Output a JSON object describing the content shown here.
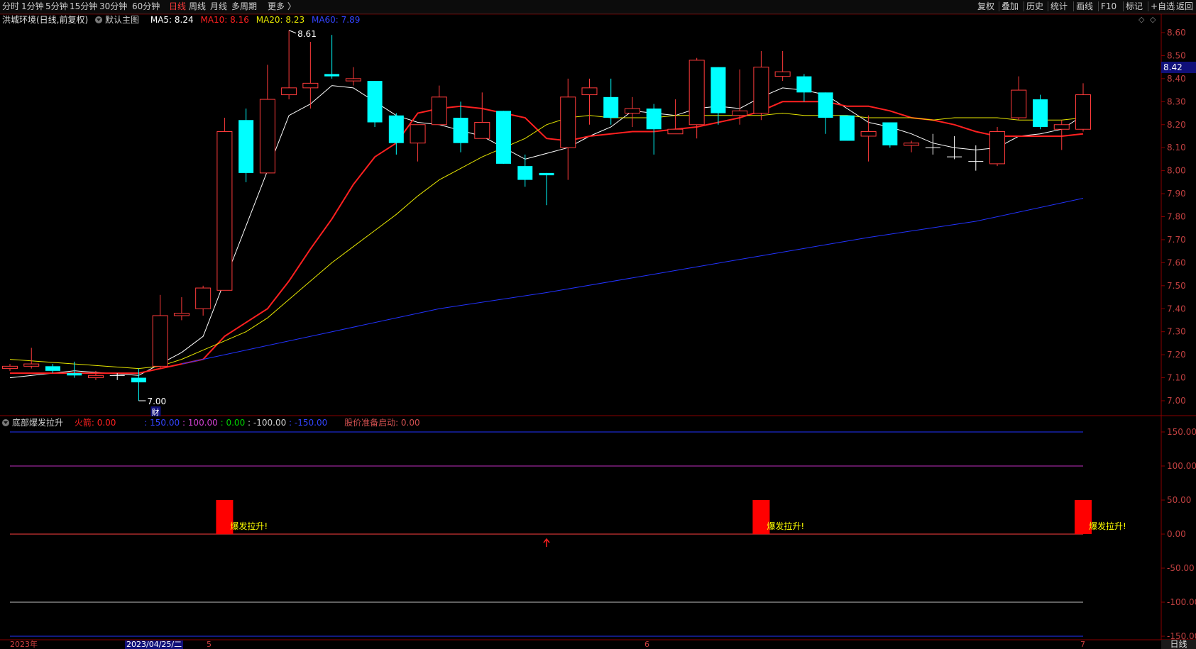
{
  "toolbar": {
    "left_items": [
      {
        "label": "分时",
        "active": false
      },
      {
        "label": "1分钟",
        "active": false
      },
      {
        "label": "5分钟",
        "active": false
      },
      {
        "label": "15分钟",
        "active": false
      },
      {
        "label": "30分钟",
        "active": false
      },
      {
        "label": "60分钟",
        "active": false
      },
      {
        "label": "日线",
        "active": true
      },
      {
        "label": "周线",
        "active": false
      },
      {
        "label": "月线",
        "active": false
      },
      {
        "label": "多周期",
        "active": false
      },
      {
        "label": "更多 〉",
        "active": false
      }
    ],
    "right_items": [
      "复权",
      "叠加",
      "历史",
      "统计",
      "画线",
      "F10",
      "标记",
      "+自选",
      "返回"
    ]
  },
  "main_legend": {
    "title": "洪城环境(日线,前复权)",
    "template": "默认主图",
    "ma5": "MA5: 8.24",
    "ma10": "MA10: 8.16",
    "ma20": "MA20: 8.23",
    "ma60": "MA60: 7.89"
  },
  "indicator_legend": {
    "name": "底部爆发拉升",
    "huojian": "火箭: 0.00",
    "v1": ": 150.00",
    "v2": ": 100.00",
    "v3": ": 0.00",
    "v4": ": -100.00",
    "v5": ": -150.00",
    "start": "股价准备启动: 0.00"
  },
  "current_price": "8.42",
  "timeframe": "日线",
  "dates": {
    "year": "2023年",
    "cursor": "2023/04/25/二",
    "m5": "5",
    "m6": "6",
    "m7": "7"
  },
  "colors": {
    "up": "#ff3b3b",
    "down": "#00ffff",
    "ma5": "#ffffff",
    "ma10": "#ff2020",
    "ma20": "#e6e600",
    "ma60": "#2233ff"
  },
  "chart_data": [
    {
      "type": "candlestick",
      "title": "洪城环境(日线,前复权)",
      "ylim": [
        7.0,
        8.6
      ],
      "y_ticks": [
        "8.60",
        "8.50",
        "8.40",
        "8.30",
        "8.20",
        "8.10",
        "8.00",
        "7.90",
        "7.80",
        "7.70",
        "7.60",
        "7.50",
        "7.40",
        "7.30",
        "7.20",
        "7.10",
        "7.00"
      ],
      "annotations": {
        "high": "8.61",
        "low": "7.00",
        "mark": "财"
      },
      "candles": [
        {
          "o": 7.14,
          "h": 7.16,
          "l": 7.13,
          "c": 7.15
        },
        {
          "o": 7.15,
          "h": 7.23,
          "l": 7.14,
          "c": 7.16
        },
        {
          "o": 7.15,
          "h": 7.16,
          "l": 7.12,
          "c": 7.13
        },
        {
          "o": 7.12,
          "h": 7.17,
          "l": 7.1,
          "c": 7.11
        },
        {
          "o": 7.1,
          "h": 7.13,
          "l": 7.09,
          "c": 7.11
        },
        {
          "o": 7.11,
          "h": 7.12,
          "l": 7.09,
          "c": 7.11
        },
        {
          "o": 7.1,
          "h": 7.14,
          "l": 7.0,
          "c": 7.08
        },
        {
          "o": 7.15,
          "h": 7.46,
          "l": 7.14,
          "c": 7.37
        },
        {
          "o": 7.37,
          "h": 7.45,
          "l": 7.35,
          "c": 7.38
        },
        {
          "o": 7.4,
          "h": 7.5,
          "l": 7.37,
          "c": 7.49
        },
        {
          "o": 7.48,
          "h": 8.23,
          "l": 7.48,
          "c": 8.17
        },
        {
          "o": 8.22,
          "h": 8.27,
          "l": 7.95,
          "c": 7.99
        },
        {
          "o": 7.99,
          "h": 8.46,
          "l": 7.99,
          "c": 8.31
        },
        {
          "o": 8.33,
          "h": 8.61,
          "l": 8.31,
          "c": 8.36
        },
        {
          "o": 8.36,
          "h": 8.56,
          "l": 8.27,
          "c": 8.38
        },
        {
          "o": 8.42,
          "h": 8.59,
          "l": 8.4,
          "c": 8.41
        },
        {
          "o": 8.39,
          "h": 8.45,
          "l": 8.37,
          "c": 8.4
        },
        {
          "o": 8.39,
          "h": 8.39,
          "l": 8.19,
          "c": 8.21
        },
        {
          "o": 8.24,
          "h": 8.25,
          "l": 8.07,
          "c": 8.12
        },
        {
          "o": 8.12,
          "h": 8.2,
          "l": 8.04,
          "c": 8.2
        },
        {
          "o": 8.2,
          "h": 8.37,
          "l": 8.2,
          "c": 8.32
        },
        {
          "o": 8.23,
          "h": 8.3,
          "l": 8.08,
          "c": 8.12
        },
        {
          "o": 8.14,
          "h": 8.34,
          "l": 8.14,
          "c": 8.21
        },
        {
          "o": 8.26,
          "h": 8.26,
          "l": 8.03,
          "c": 8.03
        },
        {
          "o": 8.02,
          "h": 8.07,
          "l": 7.93,
          "c": 7.96
        },
        {
          "o": 7.99,
          "h": 7.99,
          "l": 7.85,
          "c": 7.98
        },
        {
          "o": 8.1,
          "h": 8.4,
          "l": 7.96,
          "c": 8.32
        },
        {
          "o": 8.33,
          "h": 8.4,
          "l": 8.2,
          "c": 8.36
        },
        {
          "o": 8.32,
          "h": 8.4,
          "l": 8.2,
          "c": 8.23
        },
        {
          "o": 8.25,
          "h": 8.32,
          "l": 8.19,
          "c": 8.27
        },
        {
          "o": 8.27,
          "h": 8.29,
          "l": 8.07,
          "c": 8.18
        },
        {
          "o": 8.16,
          "h": 8.31,
          "l": 8.16,
          "c": 8.18
        },
        {
          "o": 8.2,
          "h": 8.49,
          "l": 8.14,
          "c": 8.48
        },
        {
          "o": 8.45,
          "h": 8.45,
          "l": 8.2,
          "c": 8.25
        },
        {
          "o": 8.24,
          "h": 8.44,
          "l": 8.2,
          "c": 8.26
        },
        {
          "o": 8.25,
          "h": 8.52,
          "l": 8.22,
          "c": 8.45
        },
        {
          "o": 8.41,
          "h": 8.52,
          "l": 8.39,
          "c": 8.43
        },
        {
          "o": 8.41,
          "h": 8.42,
          "l": 8.3,
          "c": 8.34
        },
        {
          "o": 8.34,
          "h": 8.34,
          "l": 8.16,
          "c": 8.23
        },
        {
          "o": 8.24,
          "h": 8.24,
          "l": 8.13,
          "c": 8.13
        },
        {
          "o": 8.15,
          "h": 8.24,
          "l": 8.04,
          "c": 8.17
        },
        {
          "o": 8.21,
          "h": 8.21,
          "l": 8.1,
          "c": 8.11
        },
        {
          "o": 8.11,
          "h": 8.13,
          "l": 8.08,
          "c": 8.12
        },
        {
          "o": 8.1,
          "h": 8.16,
          "l": 8.07,
          "c": 8.1
        },
        {
          "o": 8.06,
          "h": 8.15,
          "l": 8.05,
          "c": 8.06
        },
        {
          "o": 8.04,
          "h": 8.11,
          "l": 8.0,
          "c": 8.04
        },
        {
          "o": 8.03,
          "h": 8.19,
          "l": 8.02,
          "c": 8.17
        },
        {
          "o": 8.23,
          "h": 8.41,
          "l": 8.22,
          "c": 8.35
        },
        {
          "o": 8.31,
          "h": 8.33,
          "l": 8.18,
          "c": 8.19
        },
        {
          "o": 8.18,
          "h": 8.22,
          "l": 8.09,
          "c": 8.2
        },
        {
          "o": 8.18,
          "h": 8.38,
          "l": 8.17,
          "c": 8.33
        }
      ],
      "ma_series": [
        {
          "name": "MA5",
          "color": "#ffffff",
          "values": [
            [
              0,
              7.1
            ],
            [
              3,
              7.13
            ],
            [
              6,
              7.11
            ],
            [
              7,
              7.16
            ],
            [
              8,
              7.21
            ],
            [
              9,
              7.28
            ],
            [
              10,
              7.52
            ],
            [
              12,
              8.0
            ],
            [
              13,
              8.24
            ],
            [
              14,
              8.29
            ],
            [
              15,
              8.37
            ],
            [
              16,
              8.36
            ],
            [
              17,
              8.3
            ],
            [
              18,
              8.24
            ],
            [
              19,
              8.21
            ],
            [
              20,
              8.2
            ],
            [
              22,
              8.15
            ],
            [
              24,
              8.05
            ],
            [
              26,
              8.1
            ],
            [
              27,
              8.15
            ],
            [
              28,
              8.19
            ],
            [
              29,
              8.26
            ],
            [
              30,
              8.25
            ],
            [
              31,
              8.24
            ],
            [
              32,
              8.27
            ],
            [
              33,
              8.28
            ],
            [
              34,
              8.27
            ],
            [
              35,
              8.32
            ],
            [
              36,
              8.36
            ],
            [
              37,
              8.35
            ],
            [
              38,
              8.33
            ],
            [
              39,
              8.27
            ],
            [
              40,
              8.21
            ],
            [
              41,
              8.19
            ],
            [
              42,
              8.16
            ],
            [
              43,
              8.12
            ],
            [
              44,
              8.1
            ],
            [
              45,
              8.09
            ],
            [
              46,
              8.1
            ],
            [
              47,
              8.15
            ],
            [
              48,
              8.16
            ],
            [
              49,
              8.18
            ],
            [
              50,
              8.24
            ]
          ]
        },
        {
          "name": "MA10",
          "color": "#ff2020",
          "values": [
            [
              0,
              7.12
            ],
            [
              3,
              7.12
            ],
            [
              6,
              7.12
            ],
            [
              7,
              7.14
            ],
            [
              9,
              7.18
            ],
            [
              10,
              7.28
            ],
            [
              11,
              7.34
            ],
            [
              12,
              7.4
            ],
            [
              13,
              7.52
            ],
            [
              14,
              7.66
            ],
            [
              15,
              7.79
            ],
            [
              16,
              7.94
            ],
            [
              17,
              8.06
            ],
            [
              18,
              8.12
            ],
            [
              19,
              8.25
            ],
            [
              20,
              8.27
            ],
            [
              21,
              8.28
            ],
            [
              22,
              8.27
            ],
            [
              23,
              8.25
            ],
            [
              24,
              8.23
            ],
            [
              25,
              8.14
            ],
            [
              26,
              8.13
            ],
            [
              27,
              8.15
            ],
            [
              28,
              8.16
            ],
            [
              29,
              8.17
            ],
            [
              30,
              8.17
            ],
            [
              31,
              8.18
            ],
            [
              32,
              8.19
            ],
            [
              33,
              8.21
            ],
            [
              34,
              8.23
            ],
            [
              35,
              8.26
            ],
            [
              36,
              8.3
            ],
            [
              37,
              8.3
            ],
            [
              38,
              8.3
            ],
            [
              39,
              8.28
            ],
            [
              40,
              8.28
            ],
            [
              41,
              8.26
            ],
            [
              42,
              8.23
            ],
            [
              43,
              8.22
            ],
            [
              44,
              8.2
            ],
            [
              45,
              8.17
            ],
            [
              46,
              8.15
            ],
            [
              47,
              8.15
            ],
            [
              48,
              8.15
            ],
            [
              49,
              8.15
            ],
            [
              50,
              8.16
            ]
          ]
        },
        {
          "name": "MA20",
          "color": "#e6e600",
          "values": [
            [
              0,
              7.18
            ],
            [
              3,
              7.16
            ],
            [
              6,
              7.14
            ],
            [
              7,
              7.15
            ],
            [
              8,
              7.18
            ],
            [
              9,
              7.22
            ],
            [
              10,
              7.26
            ],
            [
              11,
              7.3
            ],
            [
              12,
              7.36
            ],
            [
              13,
              7.44
            ],
            [
              14,
              7.52
            ],
            [
              15,
              7.6
            ],
            [
              16,
              7.67
            ],
            [
              17,
              7.74
            ],
            [
              18,
              7.81
            ],
            [
              19,
              7.89
            ],
            [
              20,
              7.96
            ],
            [
              21,
              8.01
            ],
            [
              22,
              8.06
            ],
            [
              23,
              8.1
            ],
            [
              24,
              8.14
            ],
            [
              25,
              8.2
            ],
            [
              26,
              8.23
            ],
            [
              27,
              8.24
            ],
            [
              28,
              8.23
            ],
            [
              29,
              8.23
            ],
            [
              30,
              8.23
            ],
            [
              31,
              8.24
            ],
            [
              32,
              8.24
            ],
            [
              33,
              8.24
            ],
            [
              34,
              8.24
            ],
            [
              35,
              8.24
            ],
            [
              36,
              8.25
            ],
            [
              37,
              8.24
            ],
            [
              38,
              8.24
            ],
            [
              39,
              8.24
            ],
            [
              40,
              8.23
            ],
            [
              41,
              8.23
            ],
            [
              42,
              8.23
            ],
            [
              43,
              8.22
            ],
            [
              44,
              8.23
            ],
            [
              45,
              8.23
            ],
            [
              46,
              8.23
            ],
            [
              47,
              8.22
            ],
            [
              48,
              8.22
            ],
            [
              49,
              8.22
            ],
            [
              50,
              8.23
            ]
          ]
        },
        {
          "name": "MA60",
          "color": "#2233ff",
          "values": [
            [
              8,
              7.16
            ],
            [
              10,
              7.2
            ],
            [
              15,
              7.3
            ],
            [
              20,
              7.4
            ],
            [
              25,
              7.47
            ],
            [
              30,
              7.55
            ],
            [
              35,
              7.63
            ],
            [
              40,
              7.71
            ],
            [
              45,
              7.78
            ],
            [
              50,
              7.88
            ]
          ]
        }
      ]
    },
    {
      "type": "bar",
      "title": "底部爆发拉升",
      "ylim": [
        -150,
        150
      ],
      "y_ticks": [
        "150.00",
        "100.00",
        "50.00",
        "0.00",
        "-50.00",
        "-100.00",
        "-150.00"
      ],
      "levels": [
        {
          "value": 150,
          "color": "#2233ff"
        },
        {
          "value": 100,
          "color": "#c030c0"
        },
        {
          "value": 0,
          "color": "#ff4040"
        },
        {
          "value": -100,
          "color": "#c0c0c0"
        },
        {
          "value": -150,
          "color": "#2233ff"
        }
      ],
      "bars": [
        {
          "index": 10,
          "value": 50,
          "label": "爆发拉升!"
        },
        {
          "index": 35,
          "value": 50,
          "label": "爆发拉升!"
        },
        {
          "index": 50,
          "value": 50,
          "label": "爆发拉升!"
        }
      ],
      "arrow_index": 25
    }
  ]
}
